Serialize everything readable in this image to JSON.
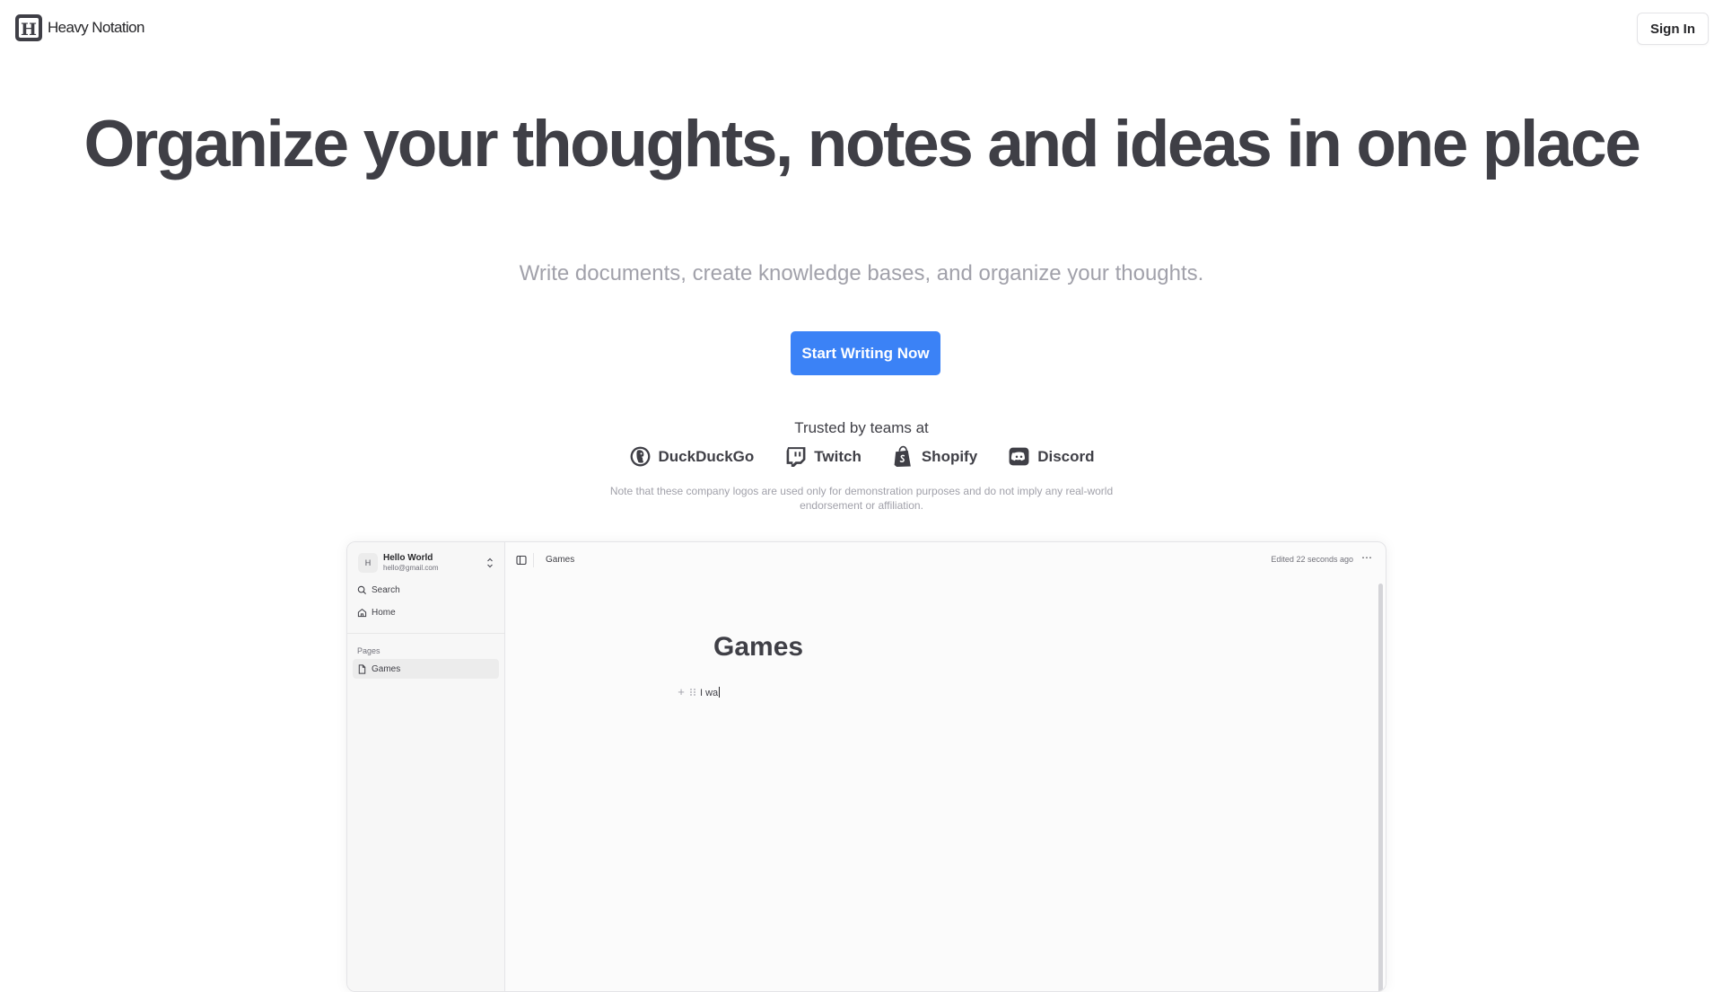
{
  "header": {
    "brand_name": "Heavy Notation",
    "signin_label": "Sign In"
  },
  "hero": {
    "title": "Organize your thoughts, notes and ideas in one place",
    "subtitle": "Write documents, create knowledge bases, and organize your thoughts.",
    "cta_label": "Start Writing Now"
  },
  "trust": {
    "heading": "Trusted by teams at",
    "companies": [
      {
        "name": "DuckDuckGo",
        "icon": "duckduckgo-icon"
      },
      {
        "name": "Twitch",
        "icon": "twitch-icon"
      },
      {
        "name": "Shopify",
        "icon": "shopify-icon"
      },
      {
        "name": "Discord",
        "icon": "discord-icon"
      }
    ],
    "disclaimer": "Note that these company logos are used only for demonstration purposes and do not imply any real-world endorsement or affiliation."
  },
  "preview": {
    "account": {
      "initial": "H",
      "name": "Hello World",
      "email": "hello@gmail.com"
    },
    "nav": {
      "search": "Search",
      "home": "Home"
    },
    "pages_heading": "Pages",
    "pages": [
      "Games"
    ],
    "breadcrumb": "Games",
    "edited": "Edited 22 seconds ago",
    "doc": {
      "title": "Games",
      "block_text": "I wa"
    }
  },
  "colors": {
    "accent": "#3b82f6",
    "text": "#3f3f46",
    "muted": "#a1a1aa"
  }
}
